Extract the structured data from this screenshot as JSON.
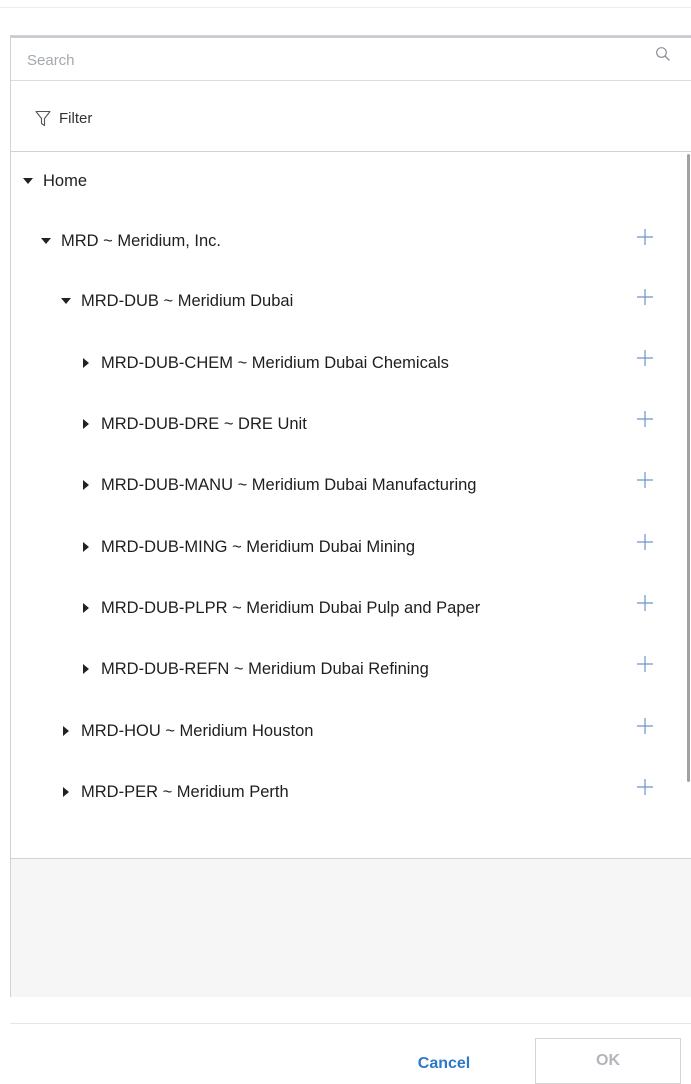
{
  "search": {
    "placeholder": "Search",
    "value": ""
  },
  "filter": {
    "label": "Filter"
  },
  "tree": {
    "root": {
      "label": "Home",
      "expanded": true
    },
    "nodes": [
      {
        "label": "MRD ~ Meridium, Inc.",
        "level": 1,
        "expanded": true
      },
      {
        "label": "MRD-DUB ~ Meridium Dubai",
        "level": 2,
        "expanded": true
      },
      {
        "label": "MRD-DUB-CHEM ~ Meridium Dubai Chemicals",
        "level": 3,
        "expanded": false
      },
      {
        "label": "MRD-DUB-DRE ~ DRE Unit",
        "level": 3,
        "expanded": false
      },
      {
        "label": "MRD-DUB-MANU ~ Meridium Dubai Manufacturing",
        "level": 3,
        "expanded": false
      },
      {
        "label": "MRD-DUB-MING ~ Meridium Dubai Mining",
        "level": 3,
        "expanded": false
      },
      {
        "label": "MRD-DUB-PLPR ~ Meridium Dubai Pulp and Paper",
        "level": 3,
        "expanded": false
      },
      {
        "label": "MRD-DUB-REFN ~ Meridium Dubai Refining",
        "level": 3,
        "expanded": false
      },
      {
        "label": "MRD-HOU ~ Meridium Houston",
        "level": 2,
        "expanded": false
      },
      {
        "label": "MRD-PER ~ Meridium Perth",
        "level": 2,
        "expanded": false
      }
    ]
  },
  "footer": {
    "cancel_label": "Cancel",
    "ok_label": "OK"
  },
  "colors": {
    "accent": "#2d79c7",
    "plus": "#6e93c9",
    "disabled_text": "#b2b6ba"
  }
}
